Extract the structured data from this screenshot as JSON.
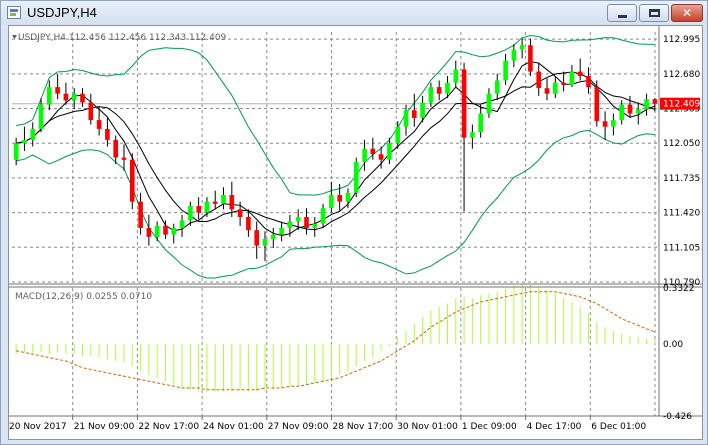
{
  "window": {
    "title": "USDJPY,H4",
    "icon": "chart-window-icon",
    "buttons": {
      "minimize": "minimize-icon",
      "maximize": "maximize-icon",
      "close": "close-icon",
      "close_glyph": "✕"
    }
  },
  "main_panel": {
    "header": "USDJPY,H4  112.456 112.456 112.343 112.409",
    "price_label": "112.409",
    "y_ticks": [
      "112.995",
      "112.680",
      "112.365",
      "112.050",
      "111.735",
      "111.420",
      "111.105",
      "110.790"
    ]
  },
  "macd_panel": {
    "header": "MACD(12,26,9) 0.0255 0.0710",
    "y_ticks": [
      "0.3322",
      "0.00",
      "-0.426"
    ]
  },
  "x_axis": {
    "labels": [
      "20 Nov 2017",
      "21 Nov 09:00",
      "22 Nov 17:00",
      "24 Nov 01:00",
      "27 Nov 09:00",
      "28 Nov 17:00",
      "30 Nov 01:00",
      "1 Dec 09:00",
      "4 Dec 17:00",
      "6 Dec 01:00"
    ]
  },
  "colors": {
    "bull_candle": "#00ff00",
    "bear_candle": "#ff0000",
    "wick": "#000000",
    "bollinger": "#009a4e",
    "moving_average": "#000000",
    "macd_histogram": "#adff2f",
    "macd_signal": "#c46a00",
    "grid": "#8a8a8a",
    "price_line": "#b0b0b0",
    "price_label_bg": "#ff0000",
    "text": "#000000"
  },
  "chart_data": {
    "type": "candlestick",
    "symbol": "USDJPY",
    "timeframe": "H4",
    "ohlc": [
      [
        111.9,
        112.1,
        111.85,
        112.05
      ],
      [
        112.05,
        112.2,
        111.98,
        112.08
      ],
      [
        112.08,
        112.24,
        112.02,
        112.18
      ],
      [
        112.18,
        112.46,
        112.15,
        112.4
      ],
      [
        112.4,
        112.62,
        112.35,
        112.56
      ],
      [
        112.56,
        112.68,
        112.45,
        112.5
      ],
      [
        112.5,
        112.6,
        112.4,
        112.44
      ],
      [
        112.44,
        112.55,
        112.36,
        112.5
      ],
      [
        112.5,
        112.55,
        112.38,
        112.42
      ],
      [
        112.42,
        112.5,
        112.22,
        112.26
      ],
      [
        112.26,
        112.38,
        112.12,
        112.18
      ],
      [
        112.18,
        112.28,
        112.02,
        112.08
      ],
      [
        112.08,
        112.12,
        111.86,
        111.92
      ],
      [
        111.92,
        112.04,
        111.8,
        111.9
      ],
      [
        111.9,
        111.96,
        111.45,
        111.52
      ],
      [
        111.52,
        111.6,
        111.22,
        111.28
      ],
      [
        111.28,
        111.4,
        111.12,
        111.2
      ],
      [
        111.2,
        111.34,
        111.16,
        111.3
      ],
      [
        111.3,
        111.35,
        111.18,
        111.22
      ],
      [
        111.22,
        111.32,
        111.14,
        111.28
      ],
      [
        111.28,
        111.4,
        111.2,
        111.35
      ],
      [
        111.35,
        111.52,
        111.3,
        111.48
      ],
      [
        111.48,
        111.56,
        111.36,
        111.42
      ],
      [
        111.42,
        111.56,
        111.38,
        111.52
      ],
      [
        111.52,
        111.62,
        111.45,
        111.5
      ],
      [
        111.5,
        111.65,
        111.45,
        111.58
      ],
      [
        111.58,
        111.7,
        111.38,
        111.45
      ],
      [
        111.45,
        111.52,
        111.3,
        111.38
      ],
      [
        111.38,
        111.45,
        111.2,
        111.26
      ],
      [
        111.26,
        111.34,
        111.0,
        111.12
      ],
      [
        111.12,
        111.25,
        110.98,
        111.18
      ],
      [
        111.18,
        111.28,
        111.1,
        111.22
      ],
      [
        111.22,
        111.34,
        111.16,
        111.28
      ],
      [
        111.28,
        111.4,
        111.2,
        111.34
      ],
      [
        111.34,
        111.45,
        111.26,
        111.38
      ],
      [
        111.38,
        111.46,
        111.22,
        111.28
      ],
      [
        111.28,
        111.38,
        111.2,
        111.32
      ],
      [
        111.32,
        111.5,
        111.28,
        111.46
      ],
      [
        111.46,
        111.7,
        111.42,
        111.58
      ],
      [
        111.58,
        111.68,
        111.44,
        111.52
      ],
      [
        111.52,
        111.64,
        111.46,
        111.6
      ],
      [
        111.6,
        111.92,
        111.56,
        111.88
      ],
      [
        111.88,
        112.08,
        111.8,
        112.0
      ],
      [
        112.0,
        112.1,
        111.9,
        111.95
      ],
      [
        111.95,
        112.02,
        111.82,
        111.9
      ],
      [
        111.9,
        112.1,
        111.86,
        112.05
      ],
      [
        112.05,
        112.25,
        112.0,
        112.2
      ],
      [
        112.2,
        112.4,
        112.12,
        112.35
      ],
      [
        112.35,
        112.5,
        112.2,
        112.28
      ],
      [
        112.28,
        112.48,
        112.24,
        112.42
      ],
      [
        112.42,
        112.6,
        112.38,
        112.56
      ],
      [
        112.56,
        112.62,
        112.44,
        112.5
      ],
      [
        112.5,
        112.66,
        112.46,
        112.6
      ],
      [
        112.6,
        112.8,
        112.55,
        112.72
      ],
      [
        112.72,
        112.78,
        111.43,
        112.1
      ],
      [
        112.1,
        112.22,
        112.0,
        112.15
      ],
      [
        112.15,
        112.4,
        112.1,
        112.32
      ],
      [
        112.32,
        112.55,
        112.28,
        112.5
      ],
      [
        112.5,
        112.68,
        112.44,
        112.62
      ],
      [
        112.62,
        112.86,
        112.58,
        112.8
      ],
      [
        112.8,
        112.95,
        112.74,
        112.9
      ],
      [
        112.9,
        113.0,
        112.82,
        112.94
      ],
      [
        112.94,
        113.0,
        112.66,
        112.7
      ],
      [
        112.7,
        112.78,
        112.48,
        112.55
      ],
      [
        112.55,
        112.64,
        112.44,
        112.5
      ],
      [
        112.5,
        112.66,
        112.46,
        112.6
      ],
      [
        112.6,
        112.7,
        112.52,
        112.58
      ],
      [
        112.58,
        112.76,
        112.56,
        112.7
      ],
      [
        112.7,
        112.82,
        112.62,
        112.66
      ],
      [
        112.66,
        112.74,
        112.5,
        112.56
      ],
      [
        112.56,
        112.62,
        112.2,
        112.25
      ],
      [
        112.25,
        112.34,
        112.08,
        112.2
      ],
      [
        112.2,
        112.32,
        112.12,
        112.26
      ],
      [
        112.26,
        112.44,
        112.22,
        112.4
      ],
      [
        112.4,
        112.48,
        112.28,
        112.32
      ],
      [
        112.32,
        112.42,
        112.22,
        112.36
      ],
      [
        112.36,
        112.5,
        112.3,
        112.45
      ],
      [
        112.45,
        112.46,
        112.34,
        112.41
      ]
    ],
    "last_price": 112.409,
    "macd": {
      "params": "12,26,9",
      "macd_value": 0.0255,
      "signal_value": 0.071,
      "histogram": [
        -0.06,
        -0.05,
        -0.06,
        -0.05,
        -0.06,
        -0.05,
        -0.06,
        -0.06,
        -0.07,
        -0.07,
        -0.08,
        -0.09,
        -0.1,
        -0.11,
        -0.13,
        -0.16,
        -0.18,
        -0.2,
        -0.22,
        -0.24,
        -0.26,
        -0.27,
        -0.28,
        -0.28,
        -0.28,
        -0.28,
        -0.28,
        -0.27,
        -0.28,
        -0.28,
        -0.28,
        -0.27,
        -0.26,
        -0.26,
        -0.25,
        -0.24,
        -0.23,
        -0.22,
        -0.2,
        -0.18,
        -0.16,
        -0.13,
        -0.1,
        -0.08,
        -0.04,
        -0.01,
        0.04,
        0.08,
        0.12,
        0.16,
        0.2,
        0.22,
        0.24,
        0.27,
        0.28,
        0.27,
        0.29,
        0.3,
        0.31,
        0.33,
        0.35,
        0.36,
        0.35,
        0.34,
        0.32,
        0.3,
        0.27,
        0.25,
        0.22,
        0.18,
        0.13,
        0.1,
        0.08,
        0.06,
        0.05,
        0.04,
        0.03,
        0.03
      ],
      "signal": [
        -0.04,
        -0.05,
        -0.06,
        -0.07,
        -0.08,
        -0.09,
        -0.1,
        -0.12,
        -0.14,
        -0.15,
        -0.16,
        -0.17,
        -0.18,
        -0.19,
        -0.2,
        -0.21,
        -0.22,
        -0.23,
        -0.24,
        -0.25,
        -0.26,
        -0.26,
        -0.26,
        -0.27,
        -0.27,
        -0.27,
        -0.27,
        -0.27,
        -0.27,
        -0.27,
        -0.26,
        -0.26,
        -0.26,
        -0.25,
        -0.25,
        -0.24,
        -0.23,
        -0.22,
        -0.21,
        -0.2,
        -0.18,
        -0.16,
        -0.14,
        -0.12,
        -0.1,
        -0.07,
        -0.04,
        -0.01,
        0.02,
        0.06,
        0.1,
        0.13,
        0.16,
        0.19,
        0.21,
        0.23,
        0.25,
        0.26,
        0.27,
        0.28,
        0.29,
        0.3,
        0.31,
        0.31,
        0.31,
        0.31,
        0.3,
        0.29,
        0.28,
        0.26,
        0.24,
        0.21,
        0.18,
        0.15,
        0.13,
        0.11,
        0.09,
        0.071
      ],
      "ylim": [
        -0.426,
        0.3322
      ]
    },
    "ylim": [
      110.79,
      113.06
    ]
  }
}
